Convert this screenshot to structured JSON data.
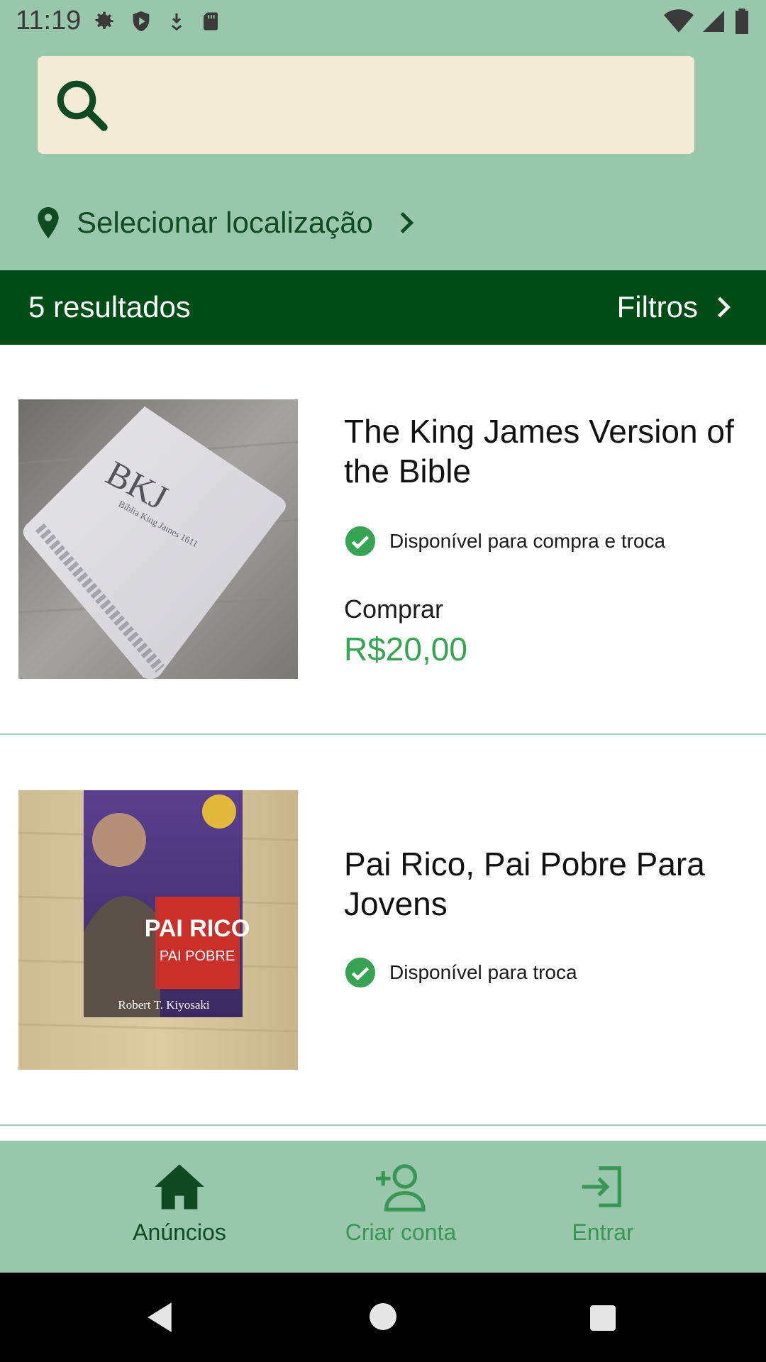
{
  "status_bar": {
    "time": "11:19",
    "left_icons": [
      "gear-icon",
      "shield-icon",
      "download-icon",
      "sd-card-icon"
    ],
    "right_icons": [
      "wifi-icon",
      "signal-icon",
      "battery-icon"
    ]
  },
  "search": {
    "placeholder": "",
    "value": ""
  },
  "location": {
    "label": "Selecionar localização"
  },
  "results": {
    "count_label": "5 resultados",
    "filters_label": "Filtros"
  },
  "listings": [
    {
      "title": "The King James Version of the Bible",
      "availability": "Disponível para compra e troca",
      "buy_label": "Comprar",
      "price": "R$20,00",
      "image_text": {
        "cover_title": "BKJ",
        "cover_sub": "Bíblia King James 1611"
      }
    },
    {
      "title": "Pai Rico, Pai Pobre Para Jovens",
      "availability": "Disponível para troca",
      "image_text": {
        "cover_title": "PAI RICO",
        "cover_sub": "PAI POBRE",
        "author": "Robert T. Kiyosaki"
      }
    }
  ],
  "bottom_nav": [
    {
      "label": "Anúncios",
      "icon": "home-icon",
      "active": true
    },
    {
      "label": "Criar conta",
      "icon": "add-user-icon",
      "active": false
    },
    {
      "label": "Entrar",
      "icon": "login-icon",
      "active": false
    }
  ],
  "colors": {
    "header_bg": "#98c7ab",
    "results_bar_bg": "#004d17",
    "search_bg": "#f3ebd6",
    "price": "#37a454",
    "active_nav": "#0f4a22",
    "inactive_nav": "#3a9654"
  }
}
